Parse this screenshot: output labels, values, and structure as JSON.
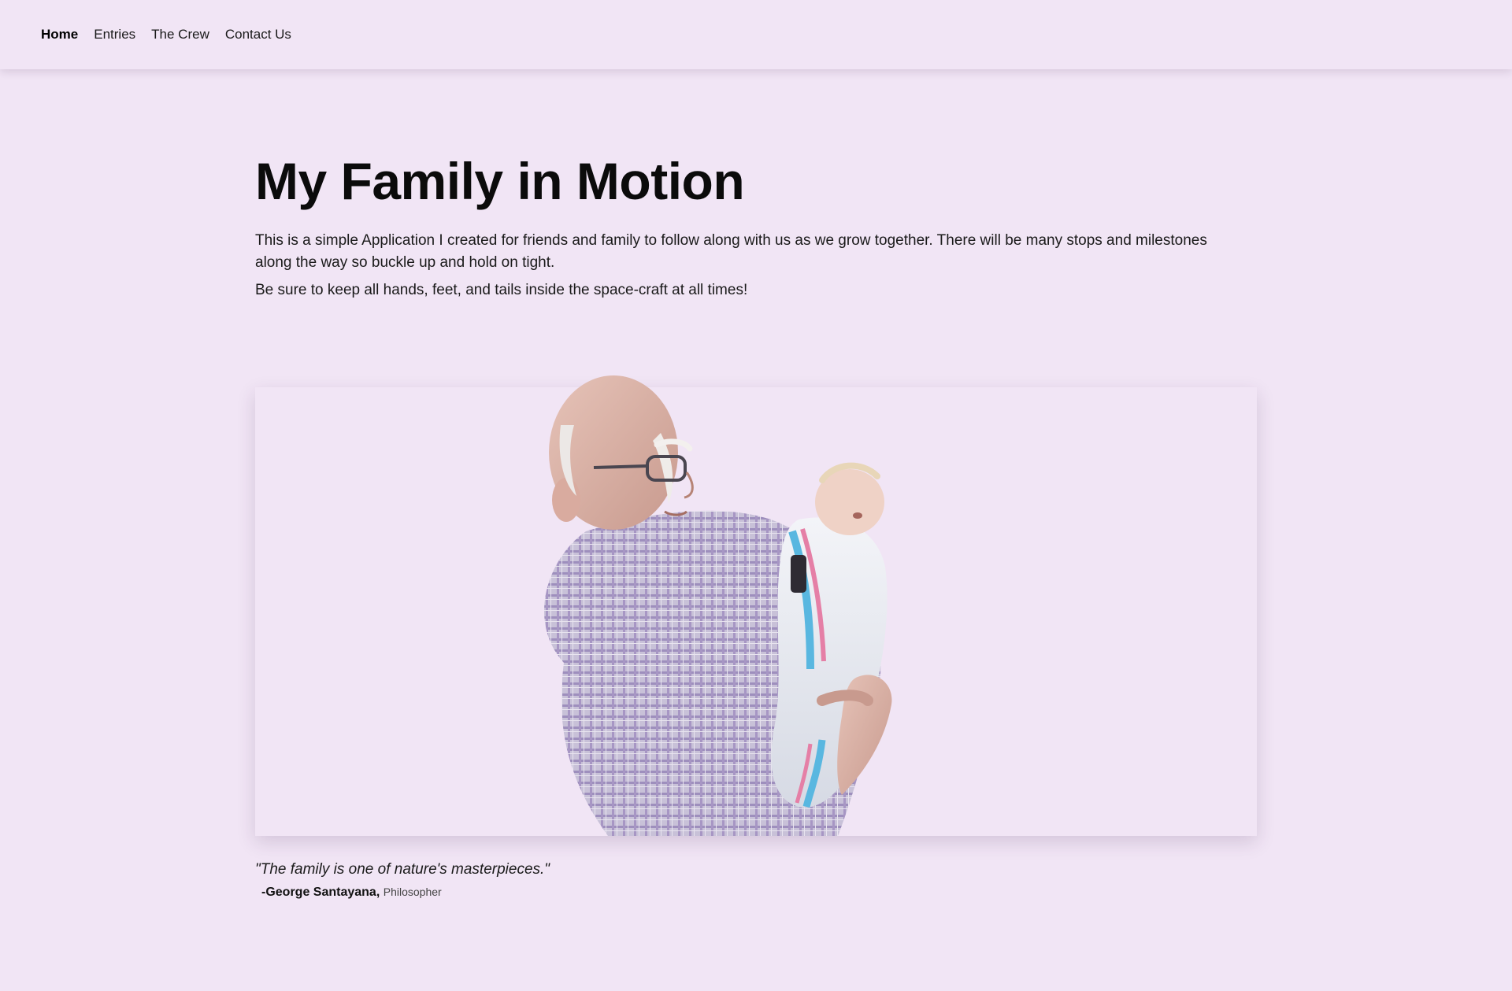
{
  "nav": {
    "items": [
      {
        "label": "Home",
        "active": true
      },
      {
        "label": "Entries",
        "active": false
      },
      {
        "label": "The Crew",
        "active": false
      },
      {
        "label": "Contact Us",
        "active": false
      }
    ]
  },
  "hero": {
    "title": "My Family in Motion",
    "intro": "This is a simple Application I created for friends and family to follow along with us as we grow together. There will be many stops and milestones along the way so buckle up and hold on tight.",
    "intro_2": "Be sure to keep all hands, feet, and tails inside the space-craft at all times!"
  },
  "photo": {
    "icon": "family-photo-grandfather-holding-newborn"
  },
  "quote": {
    "text": "\"The family is one of nature's masterpieces.\"",
    "author": "-George Santayana,",
    "role": "Philosopher"
  },
  "colors": {
    "background": "#f1e5f5",
    "text": "#111111"
  }
}
